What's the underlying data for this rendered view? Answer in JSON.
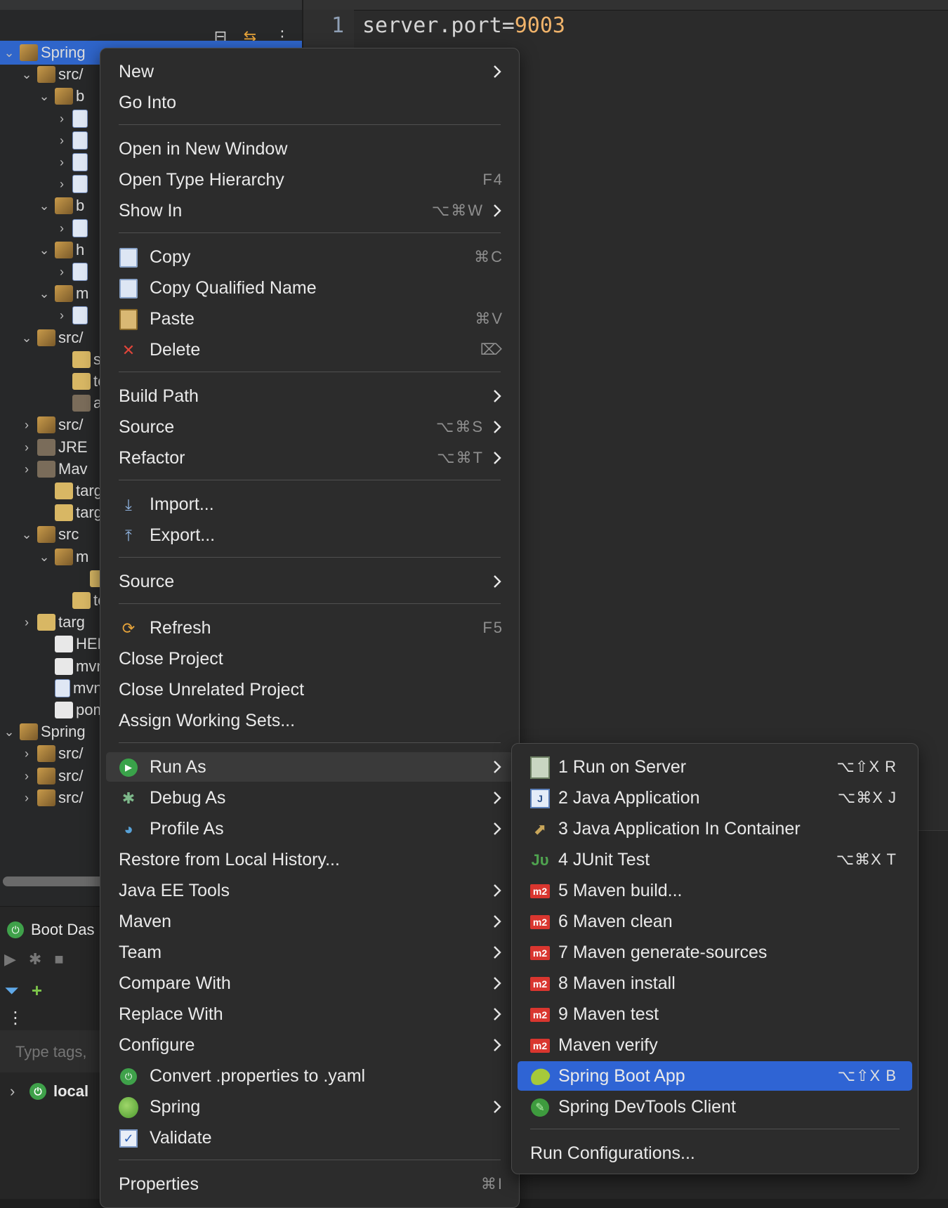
{
  "editor": {
    "line_number": "1",
    "line_key": "server.port",
    "line_eq": "=",
    "line_value": "9003"
  },
  "explorer": {
    "rows": [
      {
        "chev": "⌄",
        "icon": "pkg",
        "label": "Spring",
        "indent": 0,
        "selected": true
      },
      {
        "chev": "⌄",
        "icon": "pkg",
        "label": "src/",
        "indent": 1
      },
      {
        "chev": "⌄",
        "icon": "pkg",
        "label": "b",
        "indent": 2
      },
      {
        "chev": "›",
        "icon": "jfile",
        "label": "",
        "indent": 3
      },
      {
        "chev": "›",
        "icon": "jfile",
        "label": "",
        "indent": 3
      },
      {
        "chev": "›",
        "icon": "jfile",
        "label": "",
        "indent": 3
      },
      {
        "chev": "›",
        "icon": "jfile",
        "label": "",
        "indent": 3
      },
      {
        "chev": "⌄",
        "icon": "pkg",
        "label": "b",
        "indent": 2
      },
      {
        "chev": "›",
        "icon": "jfile",
        "label": "",
        "indent": 3
      },
      {
        "chev": "⌄",
        "icon": "pkg",
        "label": "h",
        "indent": 2
      },
      {
        "chev": "›",
        "icon": "jfile",
        "label": "",
        "indent": 3
      },
      {
        "chev": "⌄",
        "icon": "pkg",
        "label": "m",
        "indent": 2
      },
      {
        "chev": "›",
        "icon": "jfile",
        "label": "",
        "indent": 3
      },
      {
        "chev": "⌄",
        "icon": "pkg",
        "label": "src/",
        "indent": 1
      },
      {
        "chev": "",
        "icon": "folder",
        "label": "st",
        "indent": 3
      },
      {
        "chev": "",
        "icon": "folder",
        "label": "te",
        "indent": 3
      },
      {
        "chev": "",
        "icon": "lib",
        "label": "ap",
        "indent": 3
      },
      {
        "chev": "›",
        "icon": "pkg",
        "label": "src/",
        "indent": 1
      },
      {
        "chev": "›",
        "icon": "lib",
        "label": "JRE",
        "indent": 1
      },
      {
        "chev": "›",
        "icon": "lib",
        "label": "Mav",
        "indent": 1
      },
      {
        "chev": "",
        "icon": "folder",
        "label": "targ",
        "indent": 2
      },
      {
        "chev": "",
        "icon": "folder",
        "label": "targ",
        "indent": 2
      },
      {
        "chev": "⌄",
        "icon": "pkg",
        "label": "src",
        "indent": 1
      },
      {
        "chev": "⌄",
        "icon": "pkg",
        "label": "m",
        "indent": 2
      },
      {
        "chev": "",
        "icon": "folder",
        "label": "",
        "indent": 4
      },
      {
        "chev": "",
        "icon": "folder",
        "label": "te",
        "indent": 3
      },
      {
        "chev": "›",
        "icon": "folder",
        "label": "targ",
        "indent": 1
      },
      {
        "chev": "",
        "icon": "doc",
        "label": "HEL",
        "indent": 2
      },
      {
        "chev": "",
        "icon": "doc",
        "label": "mvn",
        "indent": 2
      },
      {
        "chev": "",
        "icon": "jfile",
        "label": "mvn",
        "indent": 2
      },
      {
        "chev": "",
        "icon": "doc",
        "label": "pom",
        "indent": 2
      },
      {
        "chev": "⌄",
        "icon": "pkg",
        "label": "Spring",
        "indent": 0
      },
      {
        "chev": "›",
        "icon": "pkg",
        "label": "src/",
        "indent": 1
      },
      {
        "chev": "›",
        "icon": "pkg",
        "label": "src/",
        "indent": 1
      },
      {
        "chev": "›",
        "icon": "pkg",
        "label": "src/",
        "indent": 1
      }
    ]
  },
  "boot_dashboard": {
    "title": "Boot Das",
    "search_placeholder": "Type tags,",
    "local_label": "local"
  },
  "context_menu": {
    "new": "New",
    "go_into": "Go Into",
    "open_new_window": "Open in New Window",
    "open_type_hierarchy": "Open Type Hierarchy",
    "open_type_hierarchy_sc": "F4",
    "show_in": "Show In",
    "show_in_sc": "⌥⌘W",
    "copy": "Copy",
    "copy_sc": "⌘C",
    "copy_qualified": "Copy Qualified Name",
    "paste": "Paste",
    "paste_sc": "⌘V",
    "delete": "Delete",
    "delete_sc": "⌦",
    "build_path": "Build Path",
    "source": "Source",
    "source_sc": "⌥⌘S",
    "refactor": "Refactor",
    "refactor_sc": "⌥⌘T",
    "import": "Import...",
    "export": "Export...",
    "source2": "Source",
    "refresh": "Refresh",
    "refresh_sc": "F5",
    "close_project": "Close Project",
    "close_unrelated": "Close Unrelated Project",
    "assign_working_sets": "Assign Working Sets...",
    "run_as": "Run As",
    "debug_as": "Debug As",
    "profile_as": "Profile As",
    "restore_history": "Restore from Local History...",
    "java_ee_tools": "Java EE Tools",
    "maven": "Maven",
    "team": "Team",
    "compare_with": "Compare With",
    "replace_with": "Replace With",
    "configure": "Configure",
    "convert_properties": "Convert .properties to .yaml",
    "spring": "Spring",
    "validate": "Validate",
    "properties": "Properties",
    "properties_sc": "⌘I"
  },
  "run_as_menu": {
    "run_on_server": "1 Run on Server",
    "run_on_server_sc": "⌥⇧X R",
    "java_app": "2 Java Application",
    "java_app_sc": "⌥⌘X J",
    "java_container": "3 Java Application In Container",
    "junit": "4 JUnit Test",
    "junit_sc": "⌥⌘X T",
    "maven_build": "5 Maven build...",
    "maven_clean": "6 Maven clean",
    "maven_gen": "7 Maven generate-sources",
    "maven_install": "8 Maven install",
    "maven_test": "9 Maven test",
    "maven_verify": "Maven verify",
    "spring_boot_app": "Spring Boot App",
    "spring_boot_app_sc": "⌥⇧X B",
    "devtools_client": "Spring DevTools Client",
    "run_configurations": "Run Configurations...",
    "m2_badge": "m2",
    "junit_badge": "Jυ",
    "java_badge": "J"
  }
}
